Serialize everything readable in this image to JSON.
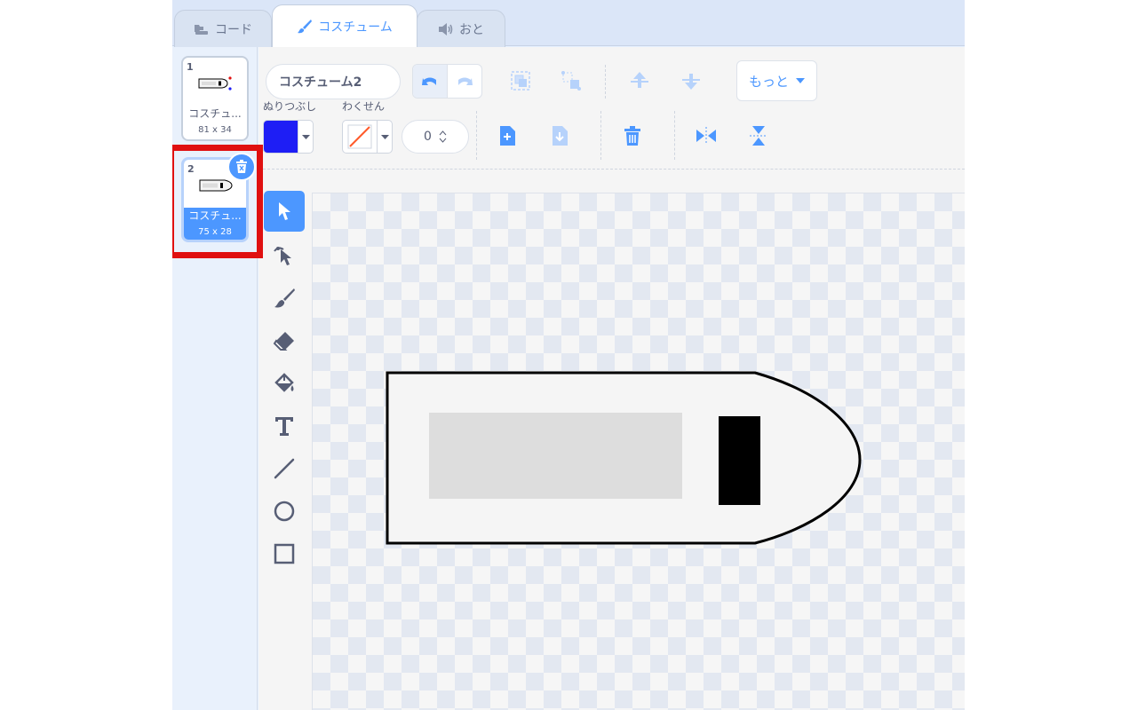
{
  "tabs": {
    "code": "コード",
    "costume": "コスチューム",
    "sound": "おと"
  },
  "costumes": [
    {
      "number": "1",
      "name": "コスチュ...",
      "size": "81 x 34",
      "selected": false
    },
    {
      "number": "2",
      "name": "コスチュ...",
      "size": "75 x 28",
      "selected": true
    }
  ],
  "editor": {
    "costume_name": "コスチューム2",
    "more_label": "もっと",
    "fill_label": "ぬりつぶし",
    "outline_label": "わくせん",
    "stroke_width": "0",
    "fill_color": "#1e1ef5",
    "accent_color": "#4c97ff",
    "highlight_color": "#e01010"
  },
  "icons": {
    "toolbar_top": [
      "undo-icon",
      "redo-icon",
      "group-icon",
      "ungroup-icon",
      "forward-icon",
      "backward-icon"
    ],
    "toolbar_bottom": [
      "copy-icon",
      "paste-icon",
      "delete-icon",
      "flip-horizontal-icon",
      "flip-vertical-icon"
    ],
    "tools": [
      "select-icon",
      "reshape-icon",
      "brush-icon",
      "eraser-icon",
      "fill-icon",
      "text-icon",
      "line-icon",
      "circle-icon",
      "rectangle-icon"
    ]
  }
}
